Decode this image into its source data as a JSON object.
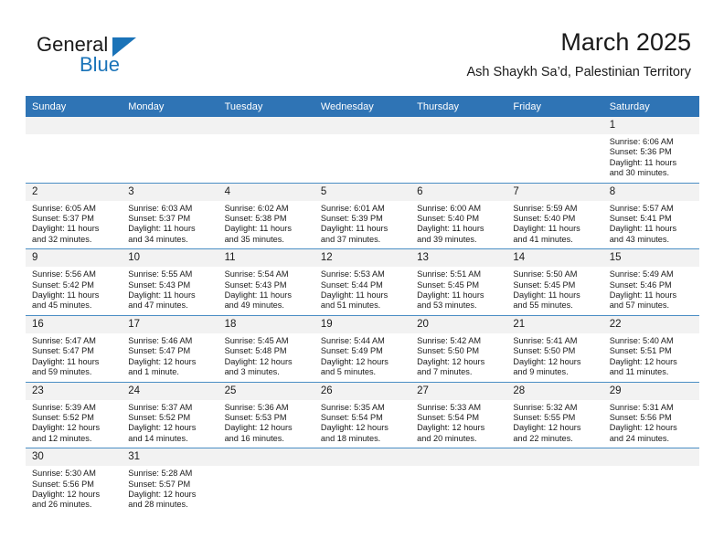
{
  "brand": {
    "name_top": "General",
    "name_bottom": "Blue",
    "accent_color": "#1a73b8"
  },
  "header": {
    "title": "March 2025",
    "subtitle": "Ash Shaykh Sa’d, Palestinian Territory",
    "header_bg_color": "#2f74b5",
    "daynum_bg_color": "#f2f2f2"
  },
  "weekday_headers": [
    "Sunday",
    "Monday",
    "Tuesday",
    "Wednesday",
    "Thursday",
    "Friday",
    "Saturday"
  ],
  "weeks": [
    [
      {
        "day": "",
        "blank": true,
        "sunrise": "",
        "sunset": "",
        "daylight_1": "",
        "daylight_2": ""
      },
      {
        "day": "",
        "blank": true,
        "sunrise": "",
        "sunset": "",
        "daylight_1": "",
        "daylight_2": ""
      },
      {
        "day": "",
        "blank": true,
        "sunrise": "",
        "sunset": "",
        "daylight_1": "",
        "daylight_2": ""
      },
      {
        "day": "",
        "blank": true,
        "sunrise": "",
        "sunset": "",
        "daylight_1": "",
        "daylight_2": ""
      },
      {
        "day": "",
        "blank": true,
        "sunrise": "",
        "sunset": "",
        "daylight_1": "",
        "daylight_2": ""
      },
      {
        "day": "",
        "blank": true,
        "sunrise": "",
        "sunset": "",
        "daylight_1": "",
        "daylight_2": ""
      },
      {
        "day": "1",
        "blank": false,
        "sunrise": "Sunrise: 6:06 AM",
        "sunset": "Sunset: 5:36 PM",
        "daylight_1": "Daylight: 11 hours",
        "daylight_2": "and 30 minutes."
      }
    ],
    [
      {
        "day": "2",
        "blank": false,
        "sunrise": "Sunrise: 6:05 AM",
        "sunset": "Sunset: 5:37 PM",
        "daylight_1": "Daylight: 11 hours",
        "daylight_2": "and 32 minutes."
      },
      {
        "day": "3",
        "blank": false,
        "sunrise": "Sunrise: 6:03 AM",
        "sunset": "Sunset: 5:37 PM",
        "daylight_1": "Daylight: 11 hours",
        "daylight_2": "and 34 minutes."
      },
      {
        "day": "4",
        "blank": false,
        "sunrise": "Sunrise: 6:02 AM",
        "sunset": "Sunset: 5:38 PM",
        "daylight_1": "Daylight: 11 hours",
        "daylight_2": "and 35 minutes."
      },
      {
        "day": "5",
        "blank": false,
        "sunrise": "Sunrise: 6:01 AM",
        "sunset": "Sunset: 5:39 PM",
        "daylight_1": "Daylight: 11 hours",
        "daylight_2": "and 37 minutes."
      },
      {
        "day": "6",
        "blank": false,
        "sunrise": "Sunrise: 6:00 AM",
        "sunset": "Sunset: 5:40 PM",
        "daylight_1": "Daylight: 11 hours",
        "daylight_2": "and 39 minutes."
      },
      {
        "day": "7",
        "blank": false,
        "sunrise": "Sunrise: 5:59 AM",
        "sunset": "Sunset: 5:40 PM",
        "daylight_1": "Daylight: 11 hours",
        "daylight_2": "and 41 minutes."
      },
      {
        "day": "8",
        "blank": false,
        "sunrise": "Sunrise: 5:57 AM",
        "sunset": "Sunset: 5:41 PM",
        "daylight_1": "Daylight: 11 hours",
        "daylight_2": "and 43 minutes."
      }
    ],
    [
      {
        "day": "9",
        "blank": false,
        "sunrise": "Sunrise: 5:56 AM",
        "sunset": "Sunset: 5:42 PM",
        "daylight_1": "Daylight: 11 hours",
        "daylight_2": "and 45 minutes."
      },
      {
        "day": "10",
        "blank": false,
        "sunrise": "Sunrise: 5:55 AM",
        "sunset": "Sunset: 5:43 PM",
        "daylight_1": "Daylight: 11 hours",
        "daylight_2": "and 47 minutes."
      },
      {
        "day": "11",
        "blank": false,
        "sunrise": "Sunrise: 5:54 AM",
        "sunset": "Sunset: 5:43 PM",
        "daylight_1": "Daylight: 11 hours",
        "daylight_2": "and 49 minutes."
      },
      {
        "day": "12",
        "blank": false,
        "sunrise": "Sunrise: 5:53 AM",
        "sunset": "Sunset: 5:44 PM",
        "daylight_1": "Daylight: 11 hours",
        "daylight_2": "and 51 minutes."
      },
      {
        "day": "13",
        "blank": false,
        "sunrise": "Sunrise: 5:51 AM",
        "sunset": "Sunset: 5:45 PM",
        "daylight_1": "Daylight: 11 hours",
        "daylight_2": "and 53 minutes."
      },
      {
        "day": "14",
        "blank": false,
        "sunrise": "Sunrise: 5:50 AM",
        "sunset": "Sunset: 5:45 PM",
        "daylight_1": "Daylight: 11 hours",
        "daylight_2": "and 55 minutes."
      },
      {
        "day": "15",
        "blank": false,
        "sunrise": "Sunrise: 5:49 AM",
        "sunset": "Sunset: 5:46 PM",
        "daylight_1": "Daylight: 11 hours",
        "daylight_2": "and 57 minutes."
      }
    ],
    [
      {
        "day": "16",
        "blank": false,
        "sunrise": "Sunrise: 5:47 AM",
        "sunset": "Sunset: 5:47 PM",
        "daylight_1": "Daylight: 11 hours",
        "daylight_2": "and 59 minutes."
      },
      {
        "day": "17",
        "blank": false,
        "sunrise": "Sunrise: 5:46 AM",
        "sunset": "Sunset: 5:47 PM",
        "daylight_1": "Daylight: 12 hours",
        "daylight_2": "and 1 minute."
      },
      {
        "day": "18",
        "blank": false,
        "sunrise": "Sunrise: 5:45 AM",
        "sunset": "Sunset: 5:48 PM",
        "daylight_1": "Daylight: 12 hours",
        "daylight_2": "and 3 minutes."
      },
      {
        "day": "19",
        "blank": false,
        "sunrise": "Sunrise: 5:44 AM",
        "sunset": "Sunset: 5:49 PM",
        "daylight_1": "Daylight: 12 hours",
        "daylight_2": "and 5 minutes."
      },
      {
        "day": "20",
        "blank": false,
        "sunrise": "Sunrise: 5:42 AM",
        "sunset": "Sunset: 5:50 PM",
        "daylight_1": "Daylight: 12 hours",
        "daylight_2": "and 7 minutes."
      },
      {
        "day": "21",
        "blank": false,
        "sunrise": "Sunrise: 5:41 AM",
        "sunset": "Sunset: 5:50 PM",
        "daylight_1": "Daylight: 12 hours",
        "daylight_2": "and 9 minutes."
      },
      {
        "day": "22",
        "blank": false,
        "sunrise": "Sunrise: 5:40 AM",
        "sunset": "Sunset: 5:51 PM",
        "daylight_1": "Daylight: 12 hours",
        "daylight_2": "and 11 minutes."
      }
    ],
    [
      {
        "day": "23",
        "blank": false,
        "sunrise": "Sunrise: 5:39 AM",
        "sunset": "Sunset: 5:52 PM",
        "daylight_1": "Daylight: 12 hours",
        "daylight_2": "and 12 minutes."
      },
      {
        "day": "24",
        "blank": false,
        "sunrise": "Sunrise: 5:37 AM",
        "sunset": "Sunset: 5:52 PM",
        "daylight_1": "Daylight: 12 hours",
        "daylight_2": "and 14 minutes."
      },
      {
        "day": "25",
        "blank": false,
        "sunrise": "Sunrise: 5:36 AM",
        "sunset": "Sunset: 5:53 PM",
        "daylight_1": "Daylight: 12 hours",
        "daylight_2": "and 16 minutes."
      },
      {
        "day": "26",
        "blank": false,
        "sunrise": "Sunrise: 5:35 AM",
        "sunset": "Sunset: 5:54 PM",
        "daylight_1": "Daylight: 12 hours",
        "daylight_2": "and 18 minutes."
      },
      {
        "day": "27",
        "blank": false,
        "sunrise": "Sunrise: 5:33 AM",
        "sunset": "Sunset: 5:54 PM",
        "daylight_1": "Daylight: 12 hours",
        "daylight_2": "and 20 minutes."
      },
      {
        "day": "28",
        "blank": false,
        "sunrise": "Sunrise: 5:32 AM",
        "sunset": "Sunset: 5:55 PM",
        "daylight_1": "Daylight: 12 hours",
        "daylight_2": "and 22 minutes."
      },
      {
        "day": "29",
        "blank": false,
        "sunrise": "Sunrise: 5:31 AM",
        "sunset": "Sunset: 5:56 PM",
        "daylight_1": "Daylight: 12 hours",
        "daylight_2": "and 24 minutes."
      }
    ],
    [
      {
        "day": "30",
        "blank": false,
        "sunrise": "Sunrise: 5:30 AM",
        "sunset": "Sunset: 5:56 PM",
        "daylight_1": "Daylight: 12 hours",
        "daylight_2": "and 26 minutes."
      },
      {
        "day": "31",
        "blank": false,
        "sunrise": "Sunrise: 5:28 AM",
        "sunset": "Sunset: 5:57 PM",
        "daylight_1": "Daylight: 12 hours",
        "daylight_2": "and 28 minutes."
      },
      {
        "day": "",
        "blank": true,
        "sunrise": "",
        "sunset": "",
        "daylight_1": "",
        "daylight_2": ""
      },
      {
        "day": "",
        "blank": true,
        "sunrise": "",
        "sunset": "",
        "daylight_1": "",
        "daylight_2": ""
      },
      {
        "day": "",
        "blank": true,
        "sunrise": "",
        "sunset": "",
        "daylight_1": "",
        "daylight_2": ""
      },
      {
        "day": "",
        "blank": true,
        "sunrise": "",
        "sunset": "",
        "daylight_1": "",
        "daylight_2": ""
      },
      {
        "day": "",
        "blank": true,
        "sunrise": "",
        "sunset": "",
        "daylight_1": "",
        "daylight_2": ""
      }
    ]
  ]
}
